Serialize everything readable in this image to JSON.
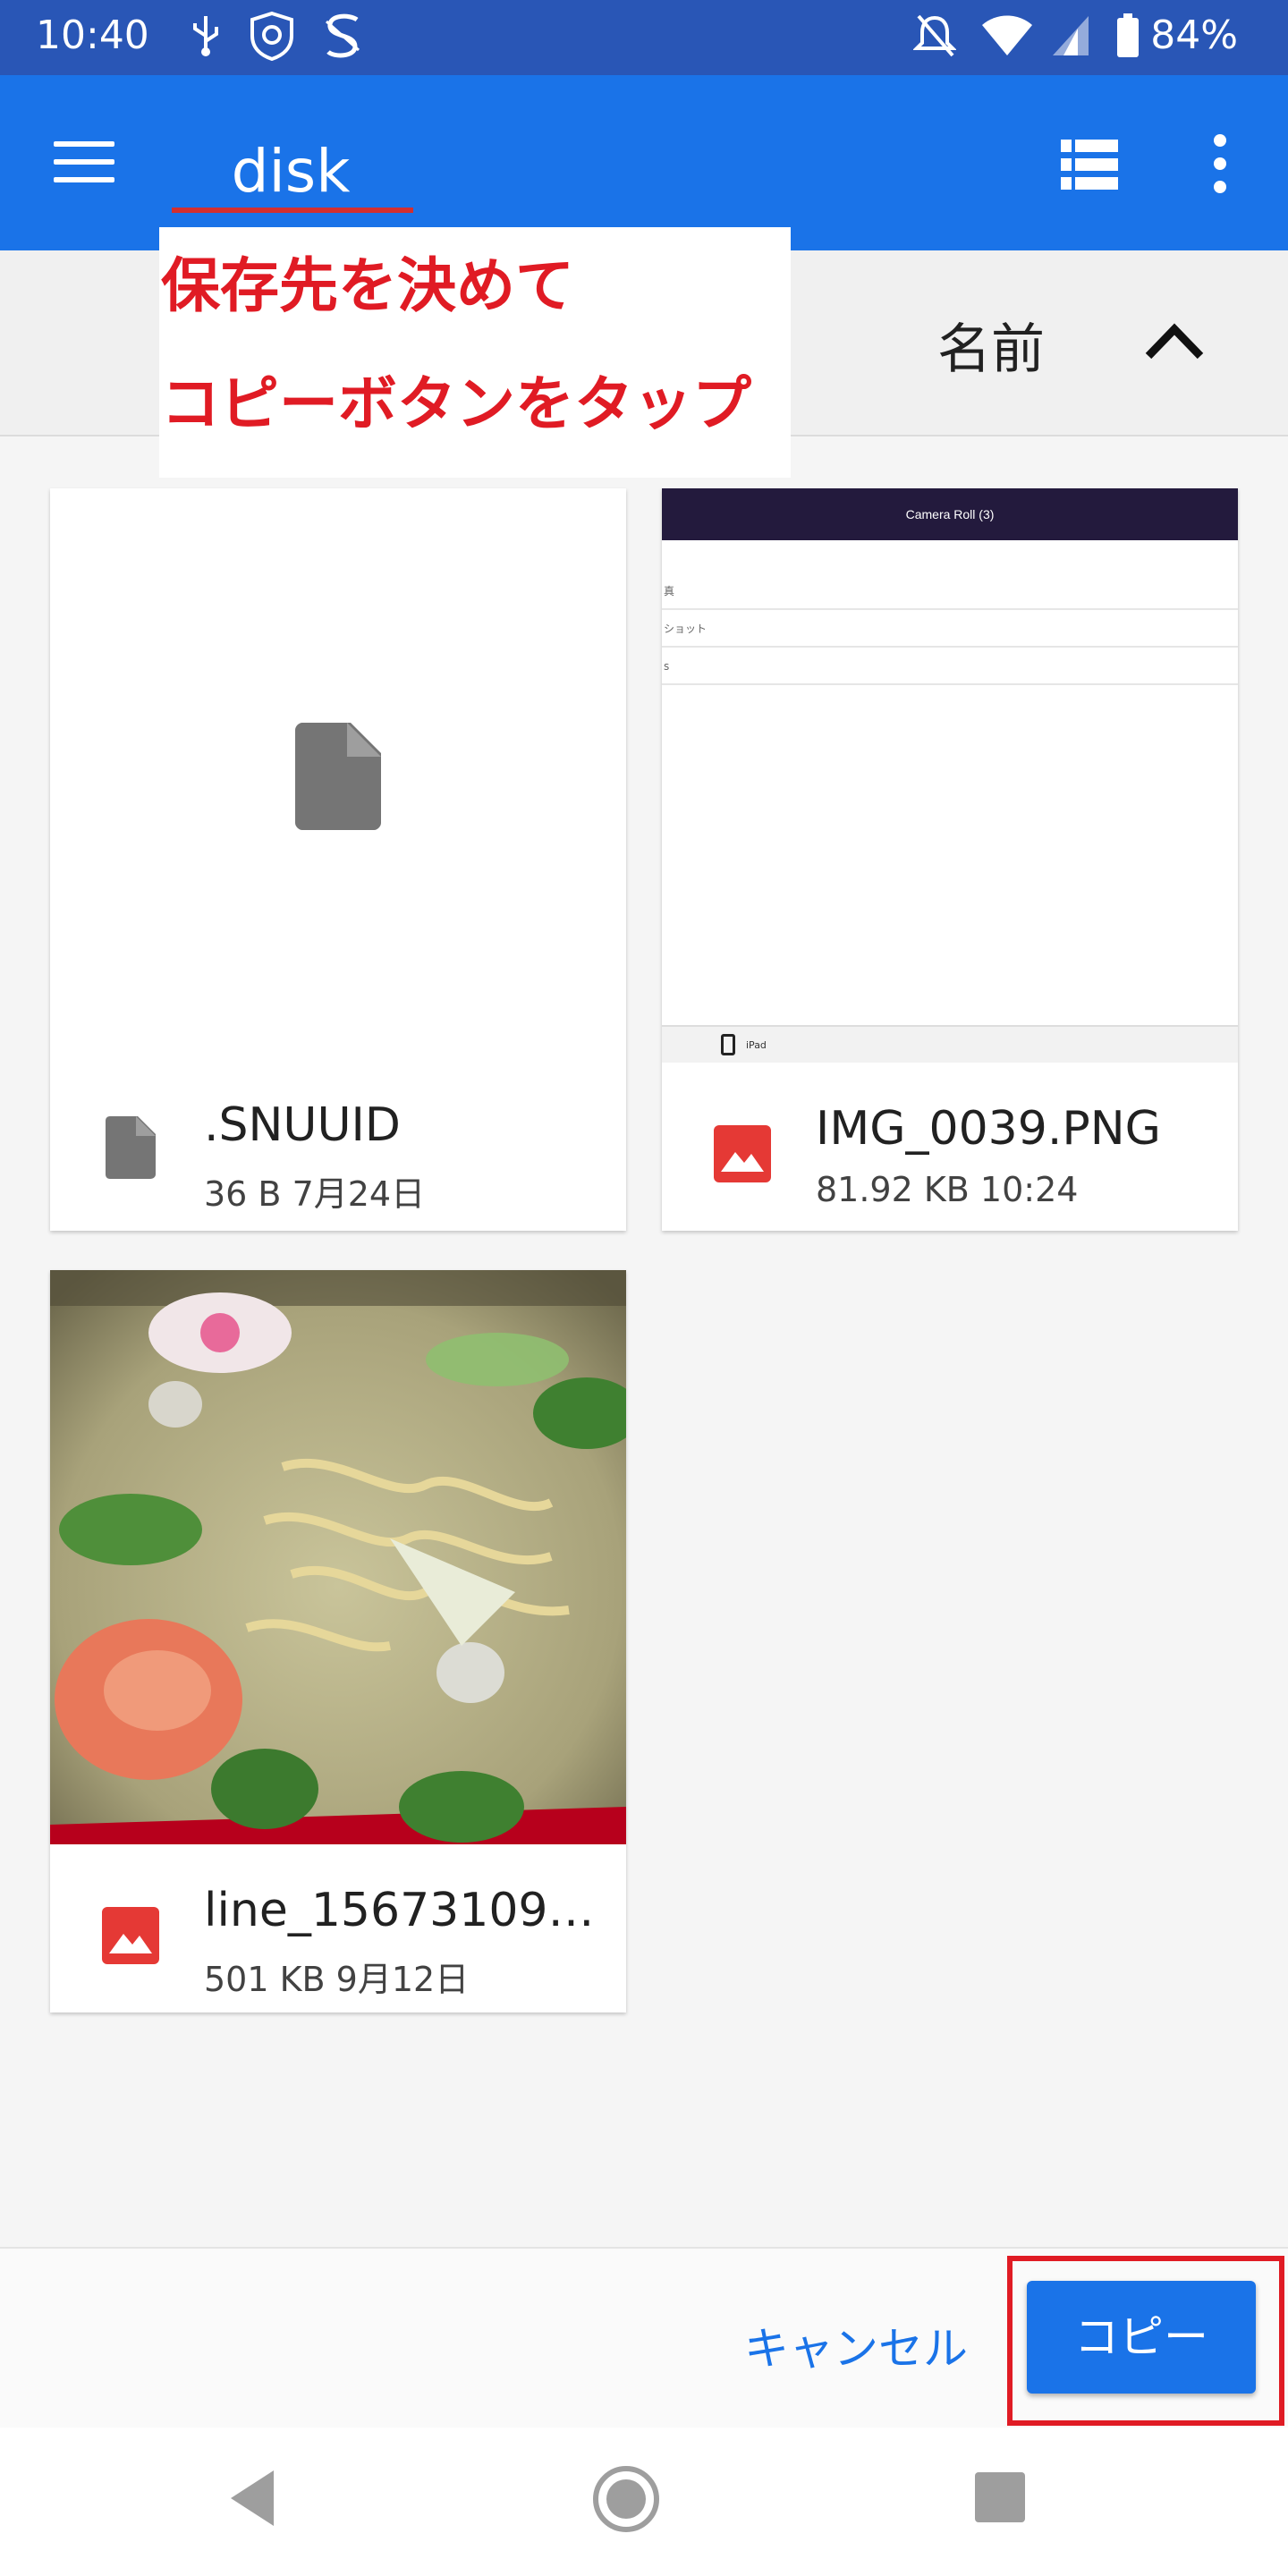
{
  "status_bar": {
    "time": "10:40",
    "battery": "84%",
    "icons": [
      "usb-icon",
      "vpn-shield-icon",
      "s-app-icon",
      "notifications-off-icon",
      "wifi-icon",
      "cell-signal-icon",
      "battery-icon"
    ]
  },
  "app_bar": {
    "tab_label": "disk",
    "icons": [
      "hamburger-menu-icon",
      "list-view-icon",
      "more-vert-icon"
    ],
    "color": "#1a73e8"
  },
  "annotation": {
    "line1": "保存先を決めて",
    "line2": "コピーボタンをタップ",
    "color": "#e01b24"
  },
  "sort_bar": {
    "label": "名前",
    "direction_icon": "chevron-up-icon"
  },
  "files": [
    {
      "name": ".SNUUID",
      "meta": "36 B 7月24日",
      "type": "file",
      "icon": "file-icon"
    },
    {
      "name": "IMG_0039.PNG",
      "meta": "81.92 KB 10:24",
      "type": "image",
      "icon": "image-icon",
      "thumb": {
        "title": "Camera Roll (3)",
        "rows": [
          "真",
          "ショット",
          "s"
        ],
        "footer": "iPad"
      }
    },
    {
      "name": "line_15673109…",
      "meta": "501 KB 9月12日",
      "type": "image",
      "icon": "image-icon"
    }
  ],
  "actions": {
    "cancel_label": "キャンセル",
    "copy_label": "コピー"
  },
  "nav_bar": {
    "icons": [
      "back-icon",
      "home-icon",
      "recents-icon"
    ]
  }
}
